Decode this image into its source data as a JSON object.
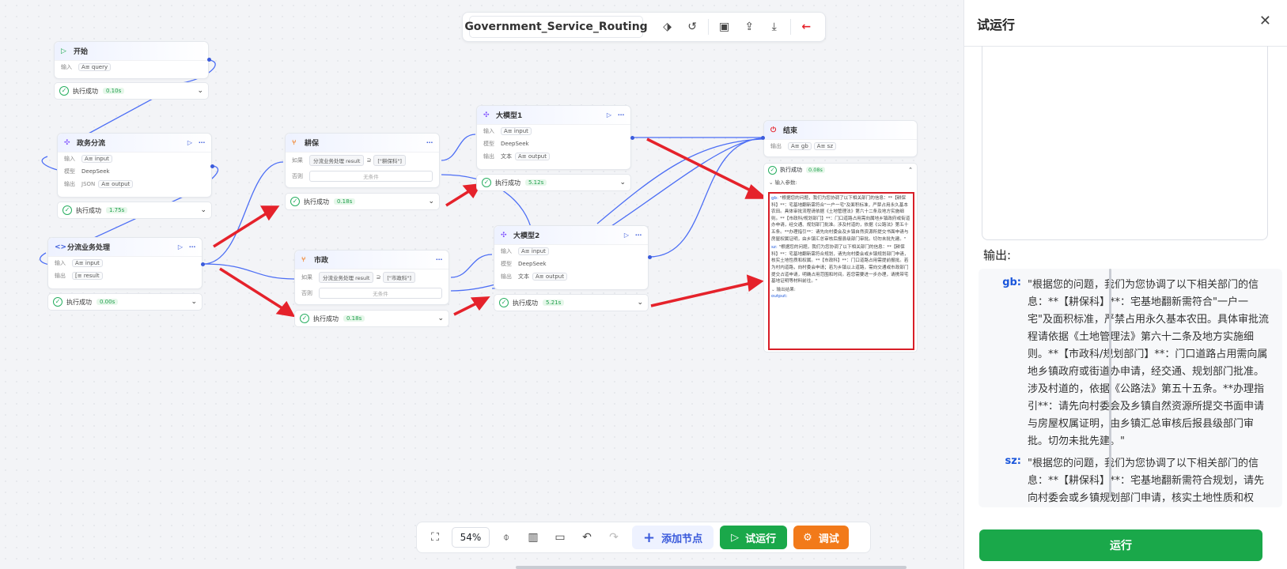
{
  "workflow": {
    "name": "Government_Service_Routing"
  },
  "nodes": {
    "start": {
      "title": "开始",
      "input_label": "输入",
      "input_var": "query",
      "status": "执行成功",
      "time": "0.10s"
    },
    "gov_route": {
      "title": "政务分流",
      "input_label": "输入",
      "input_var": "input",
      "model_label": "模型",
      "model": "DeepSeek",
      "output_label": "输出",
      "output_type": "JSON",
      "output_var": "output",
      "status": "执行成功",
      "time": "1.75s"
    },
    "dispatch": {
      "title": "分流业务处理",
      "input_label": "输入",
      "input_var": "input",
      "output_label": "输出",
      "output_var": "result",
      "status": "执行成功",
      "time": "0.00s"
    },
    "gengbao": {
      "title": "耕保",
      "if_label": "如果",
      "cond_left": "分流业务处理 result",
      "cond_op": "⊇",
      "cond_right": "[\"耕保科\"]",
      "else_label": "否则",
      "else_text": "无条件",
      "status": "执行成功",
      "time": "0.18s"
    },
    "shizheng": {
      "title": "市政",
      "if_label": "如果",
      "cond_left": "分流业务处理 result",
      "cond_op": "⊇",
      "cond_right": "[\"市政科\"]",
      "else_label": "否则",
      "else_text": "无条件",
      "status": "执行成功",
      "time": "0.18s"
    },
    "llm1": {
      "title": "大模型1",
      "input_label": "输入",
      "input_var": "input",
      "model_label": "模型",
      "model": "DeepSeek",
      "output_label": "输出",
      "output_type": "文本",
      "output_var": "output",
      "status": "执行成功",
      "time": "5.12s"
    },
    "llm2": {
      "title": "大模型2",
      "input_label": "输入",
      "input_var": "input",
      "model_label": "模型",
      "model": "DeepSeek",
      "output_label": "输出",
      "output_type": "文本",
      "output_var": "output",
      "status": "执行成功",
      "time": "5.21s"
    },
    "end": {
      "title": "结束",
      "output_label": "输出",
      "var1": "gb",
      "var2": "sz",
      "status": "执行成功",
      "time": "0.08s",
      "input_params": "输入参数:",
      "output_result": "输出结果:",
      "output_key": "output:",
      "gb_small": "\"根据您的问题，我们为您协调了以下相关部门的信息：**【耕保科】**：宅基地翻新需符合\"一户一宅\"及面积标准，严禁占用永久基本农田。具体审批流程请依据《土地管理法》第六十二条及地方实施细则。**【市政科/规划部门】**：门口道路占用需向属地乡镇政府或街道办申请，经交通、规划部门批准。涉及村道的，依据《公路法》第五十五条。**办理指引**：请先向村委会及乡镇自然资源所提交书面申请与房屋权属证明，由乡镇汇总审核后报县级部门审批。切勿未批先建。\"",
      "sz_small": "\"根据您的问题，我们为您协调了以下相关部门的信息：**【耕保科】**：宅基地翻新需符合规划，请先向村委会或乡镇规划部门申请，核实土地性质和权属。**【市政科】**：门口道路占用需提前报批。若为村内道路，向村委会申请；若为乡镇以上道路，需向交通或市政部门提交占道申请，明确占用范围和时间。若您需要进一步办理，请携带宅基地证明等材料前往。\""
    }
  },
  "toolbar_bottom": {
    "zoom": "54%",
    "add_node": "添加节点",
    "test_run": "试运行",
    "debug": "调试"
  },
  "panel": {
    "title": "试运行",
    "output_label": "输出:",
    "outputs": [
      {
        "key": "gb:",
        "value": "\"根据您的问题，我们为您协调了以下相关部门的信息：**【耕保科】**：宅基地翻新需符合\"一户一宅\"及面积标准，严禁占用永久基本农田。具体审批流程请依据《土地管理法》第六十二条及地方实施细则。**【市政科/规划部门】**：门口道路占用需向属地乡镇政府或街道办申请，经交通、规划部门批准。涉及村道的，依据《公路法》第五十五条。**办理指引**：请先向村委会及乡镇自然资源所提交书面申请与房屋权属证明，由乡镇汇总审核后报县级部门审批。切勿未批先建。\""
      },
      {
        "key": "sz:",
        "value": "\"根据您的问题，我们为您协调了以下相关部门的信息：**【耕保科】**：宅基地翻新需符合规划，请先向村委会或乡镇规划部门申请，核实土地性质和权属。**【市政科】**：门口道路占用需提前报批。若为村内道路、向"
      }
    ],
    "run_button": "运行"
  }
}
